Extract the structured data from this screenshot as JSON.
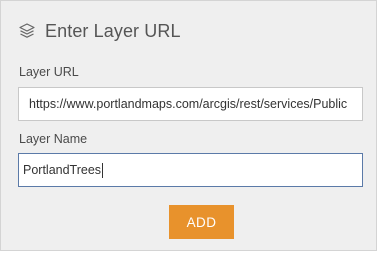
{
  "dialog": {
    "title": "Enter Layer URL",
    "title_icon": "layers-icon"
  },
  "fields": {
    "url": {
      "label": "Layer URL",
      "value": "https://www.portlandmaps.com/arcgis/rest/services/Public"
    },
    "name": {
      "label": "Layer Name",
      "value": "PortlandTrees"
    }
  },
  "actions": {
    "add_label": "ADD"
  },
  "colors": {
    "accent": "#e8922c",
    "panel_background": "#efefef",
    "focus_border": "#5b7aa8"
  }
}
